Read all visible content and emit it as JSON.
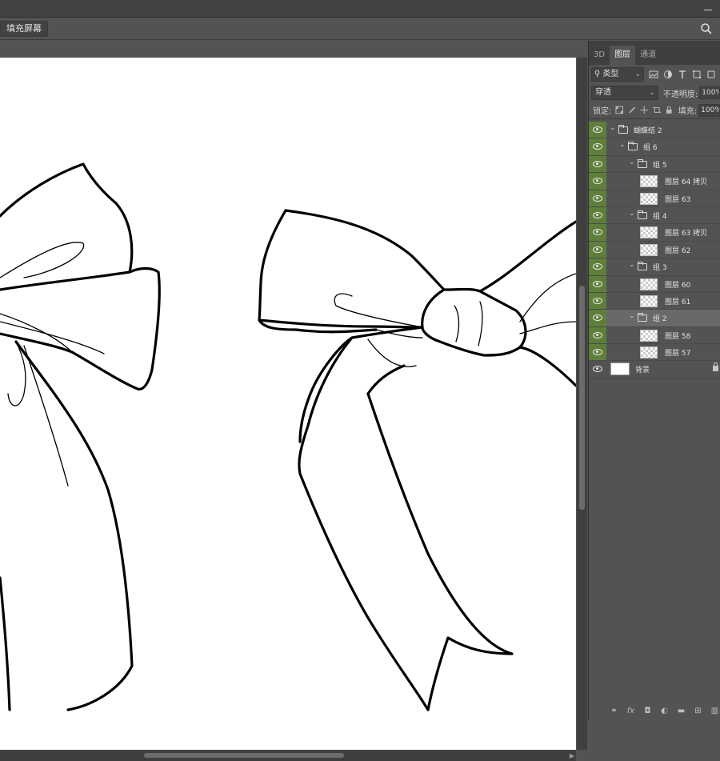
{
  "options_bar": {
    "fill_button_label": "填充屏幕"
  },
  "panel": {
    "tabs": [
      {
        "label": "3D",
        "active": false
      },
      {
        "label": "图层",
        "active": true
      },
      {
        "label": "通道",
        "active": false
      }
    ],
    "filter_kind_label": "类型",
    "blend_mode_value": "穿透",
    "opacity_label": "不透明度:",
    "opacity_value": "100%",
    "lock_label": "锁定:",
    "fill_label": "填充:",
    "fill_value": "100%"
  },
  "layers": [
    {
      "name": "蝴蝶结 2",
      "type": "group",
      "depth": 0,
      "visible": true
    },
    {
      "name": "组 6",
      "type": "group",
      "depth": 1,
      "visible": true
    },
    {
      "name": "组 5",
      "type": "group",
      "depth": 2,
      "visible": true
    },
    {
      "name": "图层 64 拷贝",
      "type": "layer",
      "depth": 3,
      "visible": true
    },
    {
      "name": "图层 63",
      "type": "layer",
      "depth": 3,
      "visible": true
    },
    {
      "name": "组 4",
      "type": "group",
      "depth": 2,
      "visible": true
    },
    {
      "name": "图层 63 拷贝",
      "type": "layer",
      "depth": 3,
      "visible": true
    },
    {
      "name": "图层 62",
      "type": "layer",
      "depth": 3,
      "visible": true
    },
    {
      "name": "组 3",
      "type": "group",
      "depth": 2,
      "visible": true
    },
    {
      "name": "图层 60",
      "type": "layer",
      "depth": 3,
      "visible": true
    },
    {
      "name": "图层 61",
      "type": "layer",
      "depth": 3,
      "visible": true
    },
    {
      "name": "组 2",
      "type": "group",
      "depth": 2,
      "visible": true,
      "selected": true
    },
    {
      "name": "图层 58",
      "type": "layer",
      "depth": 3,
      "visible": true
    },
    {
      "name": "图层 57",
      "type": "layer",
      "depth": 3,
      "visible": true
    },
    {
      "name": "背景",
      "type": "background",
      "depth": 0,
      "visible": true,
      "locked": true
    }
  ],
  "colors": {
    "eye_active": "#5e7f3a",
    "panel_bg": "#535353",
    "selected_row": "#696969"
  }
}
